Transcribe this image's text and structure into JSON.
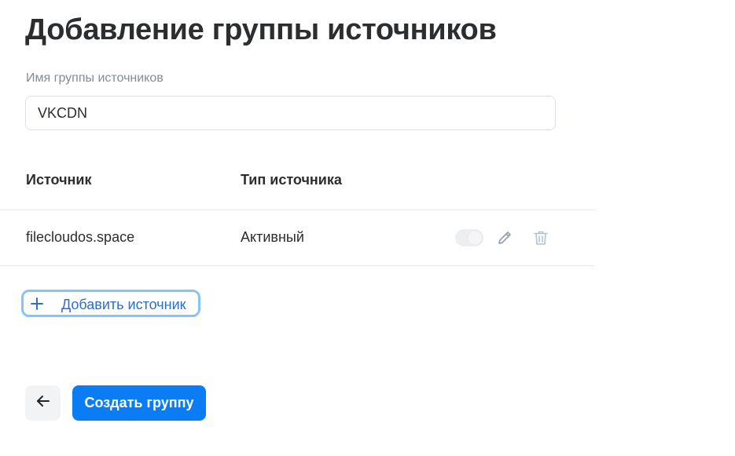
{
  "page": {
    "title": "Добавление группы источников"
  },
  "form": {
    "group_name_label": "Имя группы источников",
    "group_name_value": "VKCDN"
  },
  "table": {
    "columns": [
      "Источник",
      "Тип источника"
    ],
    "rows": [
      {
        "source": "filecloudos.space",
        "type": "Активный",
        "enabled": true
      }
    ]
  },
  "actions": {
    "add_source_label": "Добавить источник",
    "create_group_label": "Создать группу"
  },
  "icons": {
    "toggle": "toggle-switch",
    "edit": "pencil-icon",
    "delete": "trash-icon",
    "add": "plus-icon",
    "back": "arrow-left-icon"
  },
  "colors": {
    "primary": "#0a7df5",
    "link": "#2d6fc4",
    "focus_ring": "#89c2f5",
    "muted_text": "#818c99"
  }
}
